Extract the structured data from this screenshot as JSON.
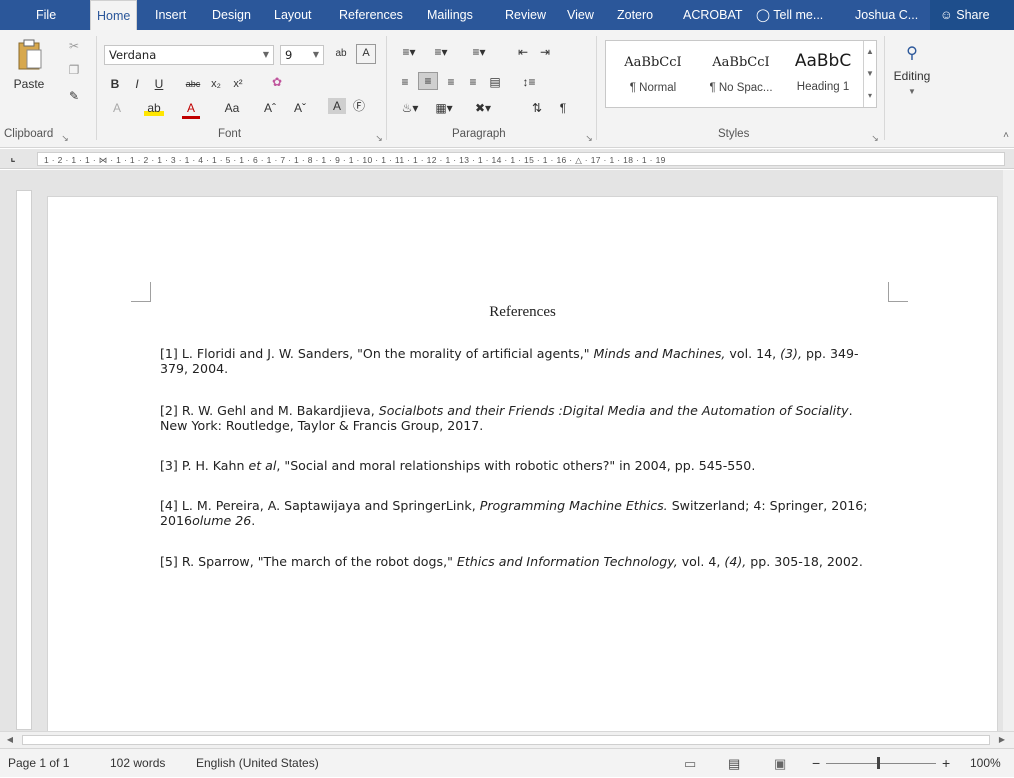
{
  "tabs": [
    "File",
    "Home",
    "Insert",
    "Design",
    "Layout",
    "References",
    "Mailings",
    "Review",
    "View",
    "Zotero",
    "ACROBAT"
  ],
  "tell_me": "Tell me...",
  "user_name": "Joshua C...",
  "share_label": "Share",
  "clipboard": {
    "paste_label": "Paste",
    "group_label": "Clipboard"
  },
  "font": {
    "family": "Verdana",
    "size": "9",
    "group_label": "Font",
    "change_case": "Aa"
  },
  "paragraph": {
    "group_label": "Paragraph"
  },
  "styles": {
    "group_label": "Styles",
    "items": [
      {
        "sample": "AaBbCcI",
        "name": "¶ Normal"
      },
      {
        "sample": "AaBbCcI",
        "name": "¶ No Spac..."
      },
      {
        "sample": "AaBbC",
        "name": "Heading 1"
      }
    ]
  },
  "editing": {
    "label": "Editing"
  },
  "document": {
    "title": "References",
    "references": [
      {
        "number": "[1]",
        "pre": "L. Floridi and J. W. Sanders, \"On the morality of artificial agents,\" ",
        "italic": "Minds and Machines,",
        "post": " vol. 14, ",
        "italic2": "(3),",
        "post2": " pp. 349-379, 2004."
      },
      {
        "number": "[2]",
        "pre": "R. W. Gehl and M. Bakardjieva, ",
        "italic": "Socialbots and their Friends :Digital Media and the Automation of Sociality",
        "post": ". New York: Routledge, Taylor & Francis Group, 2017.",
        "italic2": "",
        "post2": ""
      },
      {
        "number": "[3]",
        "pre": "P. H. Kahn ",
        "italic": "et al",
        "post": ", \"Social and moral relationships with robotic others?\" in 2004, pp. 545-550.",
        "italic2": "",
        "post2": ""
      },
      {
        "number": "[4]",
        "pre": "L. M. Pereira, A. Saptawijaya and SpringerLink, ",
        "italic": "Programming Machine Ethics.",
        "post": " Switzerland; 4: Springer, 2016; 2016",
        "italic2": "olume 26",
        "post2": "."
      },
      {
        "number": "[5]",
        "pre": "R. Sparrow, \"The march of the robot dogs,\" ",
        "italic": "Ethics and Information Technology,",
        "post": " vol. 4, ",
        "italic2": "(4),",
        "post2": " pp. 305-18, 2002."
      }
    ]
  },
  "ruler_text": "1 · 2 · 1 · 1 · ⋈ · 1 · 1 · 2 · 1 · 3 · 1 · 4 · 1 · 5 · 1 · 6 · 1 · 7 · 1 · 8 · 1 · 9 · 1 · 10 · 1 · 11 · 1 · 12 · 1 · 13 · 1 · 14 · 1 · 15 · 1 · 16 · △ · 17 · 1 · 18 · 1 · 19",
  "status": {
    "page": "Page 1 of 1",
    "words": "102 words",
    "language": "English (United States)",
    "zoom": "100%"
  },
  "colors": {
    "accent": "#2b579a"
  }
}
